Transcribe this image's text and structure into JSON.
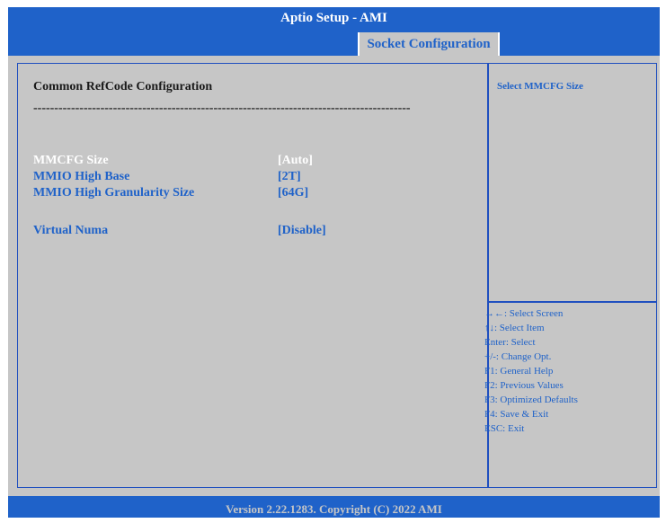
{
  "header": {
    "title": "Aptio Setup  - AMI",
    "active_tab": "Socket Configuration"
  },
  "main": {
    "section_title": "Common RefCode Configuration",
    "separator": "------------------------------------------------------------------------------------------",
    "settings": [
      {
        "label": "MMCFG Size",
        "value": "[Auto]",
        "selected": true
      },
      {
        "label": "MMIO High Base",
        "value": "[2T]",
        "selected": false
      },
      {
        "label": "MMIO High Granularity Size",
        "value": "[64G]",
        "selected": false
      },
      {
        "label": "Virtual Numa",
        "value": "[Disable]",
        "selected": false
      }
    ]
  },
  "help": {
    "text": "Select MMCFG Size"
  },
  "keys": [
    "→←: Select Screen",
    "↑↓: Select Item",
    "Enter: Select",
    "+/-: Change Opt.",
    "F1: General Help",
    "F2: Previous Values",
    "F3: Optimized Defaults",
    "F4: Save & Exit",
    "ESC: Exit"
  ],
  "footer": {
    "version": "Version 2.22.1283. Copyright (C) 2022 AMI"
  },
  "colors": {
    "accent_blue": "#1f62c9",
    "panel_gray": "#c6c6c6",
    "selected_text": "#ffffff"
  }
}
